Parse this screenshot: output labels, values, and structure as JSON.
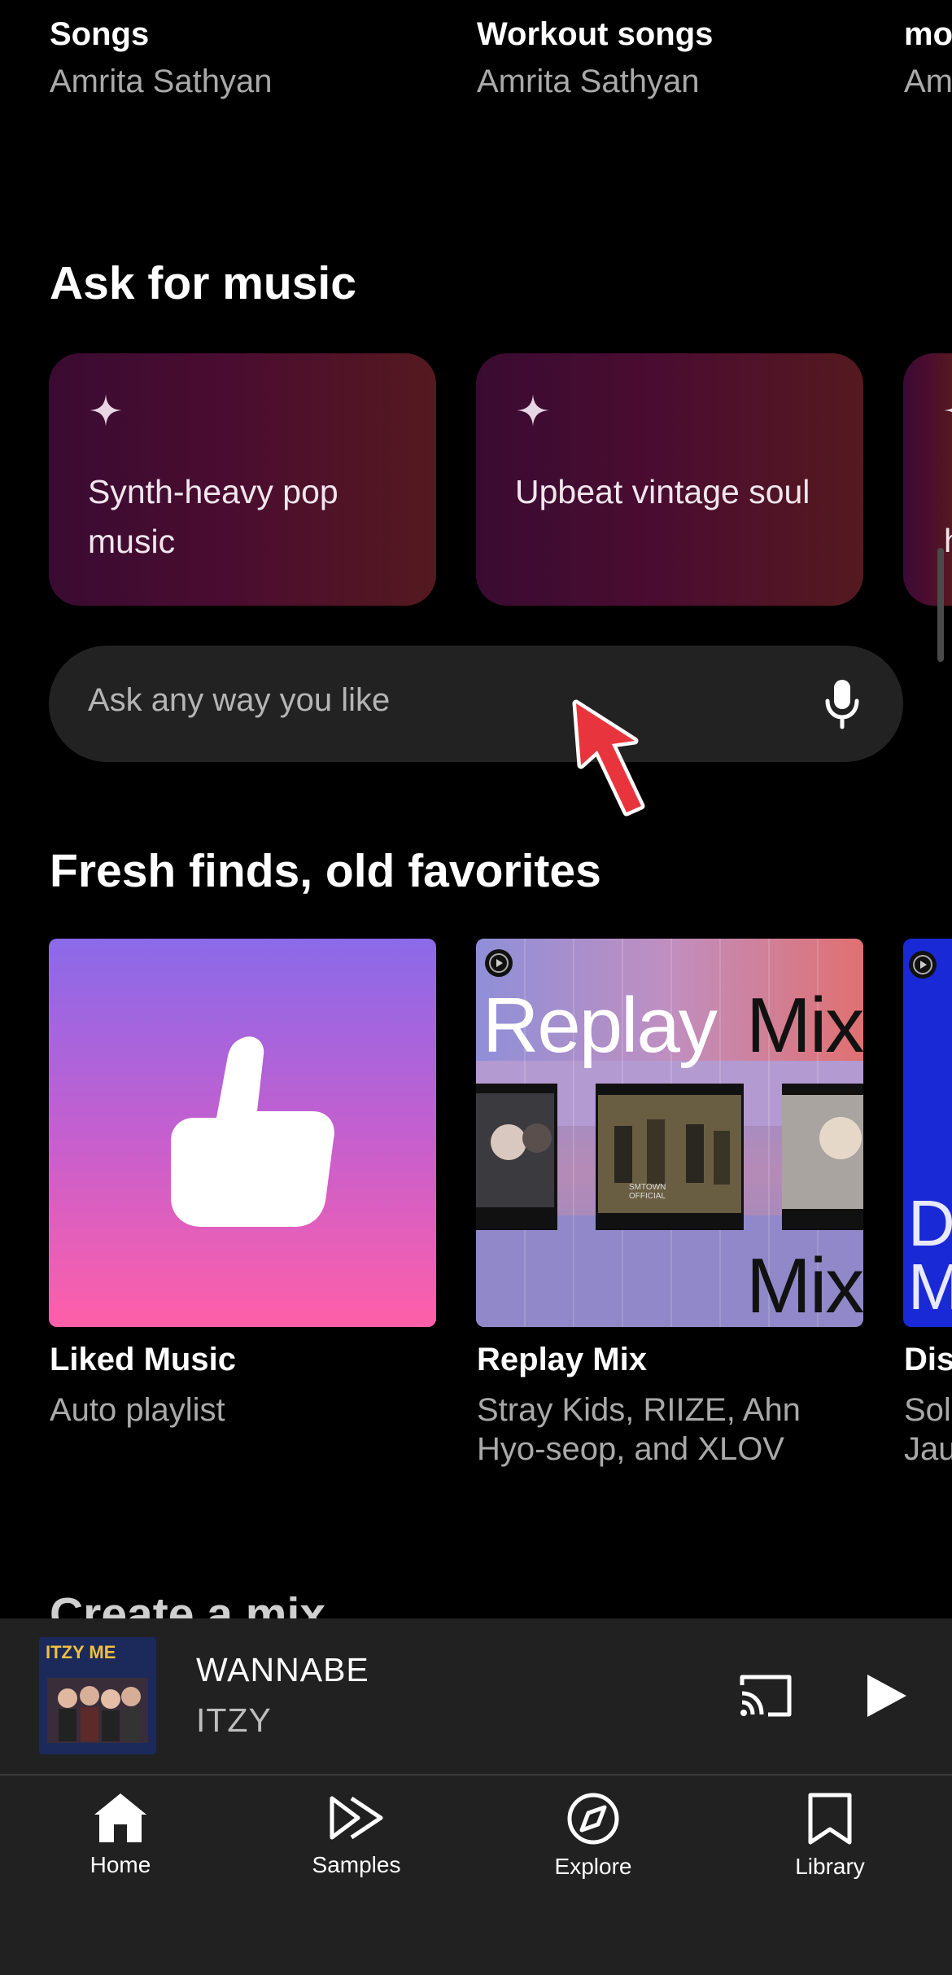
{
  "top_row": [
    {
      "title": "Songs",
      "subtitle": "Amrita Sathyan"
    },
    {
      "title": "Workout songs",
      "subtitle": "Amrita Sathyan"
    },
    {
      "title": "mo",
      "subtitle": "Am"
    }
  ],
  "ask_section": {
    "title": "Ask for music",
    "cards": [
      {
        "label": "Synth-heavy pop music",
        "icon": "sparkle-icon"
      },
      {
        "label": "Upbeat vintage soul",
        "icon": "sparkle-icon"
      },
      {
        "label": "h",
        "icon": "sparkle-icon"
      }
    ],
    "search_placeholder": "Ask any way you like",
    "mic_icon": "mic-icon"
  },
  "fresh_section": {
    "title": "Fresh finds, old favorites",
    "cards": [
      {
        "title": "Liked Music",
        "subtitle": "Auto playlist",
        "icon": "thumbs-up-icon"
      },
      {
        "title": "Replay Mix",
        "subtitle": "Stray Kids, RIIZE, Ahn Hyo-seop, and XLOV",
        "art_top_left": "Replay",
        "art_top_right": "Mix",
        "art_bottom": "Mix",
        "badge_text": "SMTOWN OFFICIAL"
      },
      {
        "title": "Dis",
        "subtitle": "Sol Jau",
        "art_text_1": "D",
        "art_text_2": "M"
      }
    ]
  },
  "next_section_title": "Create a mix",
  "now_playing": {
    "song": "WANNABE",
    "artist": "ITZY",
    "album_art_text": "ITZY ME",
    "cast_icon": "cast-icon",
    "play_icon": "play-icon"
  },
  "nav": [
    {
      "label": "Home",
      "icon": "home-icon",
      "active": true
    },
    {
      "label": "Samples",
      "icon": "samples-icon",
      "active": false
    },
    {
      "label": "Explore",
      "icon": "explore-icon",
      "active": false
    },
    {
      "label": "Library",
      "icon": "library-icon",
      "active": false
    }
  ],
  "colors": {
    "background": "#000000",
    "card_gradient_start": "#3a0b32",
    "card_gradient_end": "#55191f",
    "player_bg": "#212121",
    "arrow": "#e8353d"
  }
}
